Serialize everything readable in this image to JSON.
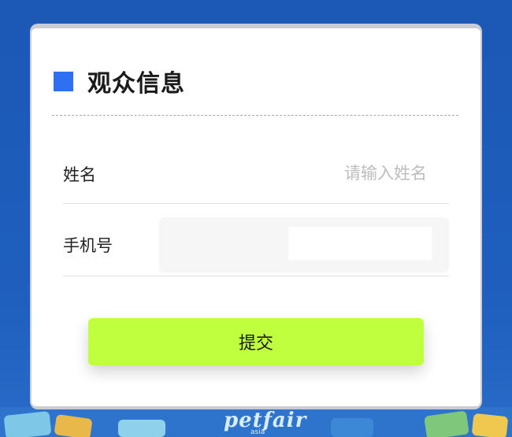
{
  "form": {
    "title": "观众信息",
    "name_label": "姓名",
    "name_placeholder": "请输入姓名",
    "name_value": "",
    "phone_label": "手机号",
    "phone_value": "",
    "submit_label": "提交"
  },
  "banner": {
    "logo_text": "petfair",
    "logo_sub": "asia"
  },
  "colors": {
    "page_background": "#1e5bb8",
    "title_square": "#2f6ff2",
    "submit_button": "#c0ff3d",
    "card": "#ffffff"
  }
}
